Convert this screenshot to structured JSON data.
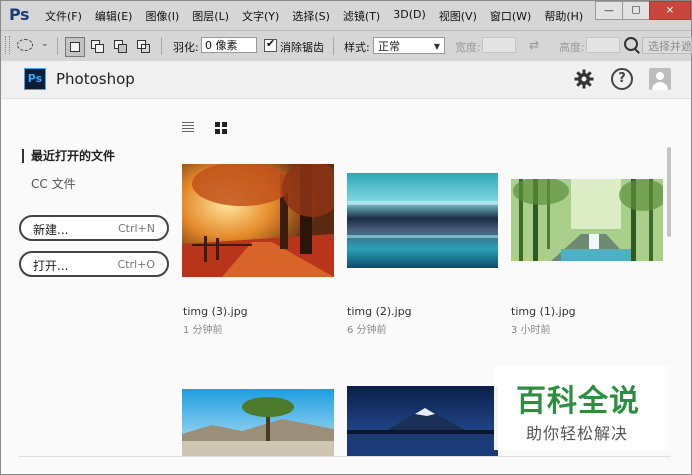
{
  "menubar": {
    "logo": "Ps",
    "items": [
      "文件(F)",
      "编辑(E)",
      "图像(I)",
      "图层(L)",
      "文字(Y)",
      "选择(S)",
      "滤镜(T)",
      "3D(D)",
      "视图(V)",
      "窗口(W)",
      "帮助(H)"
    ]
  },
  "options": {
    "feather_label": "羽化:",
    "feather_value": "0 像素",
    "antialias_label": "消除锯齿",
    "antialias_checked": true,
    "style_label": "样式:",
    "style_value": "正常",
    "width_label": "宽度:",
    "height_label": "高度:",
    "select_mask_label": "选择并遮住..."
  },
  "start": {
    "app_name": "Photoshop",
    "badge": "Ps",
    "nav": {
      "recent_label": "最近打开的文件",
      "cc_label": "CC 文件"
    },
    "new_button": {
      "label": "新建...",
      "shortcut": "Ctrl+N"
    },
    "open_button": {
      "label": "打开...",
      "shortcut": "Ctrl+O"
    },
    "files": [
      {
        "name": "timg (3).jpg",
        "time": "1 分钟前"
      },
      {
        "name": "timg (2).jpg",
        "time": "6 分钟前"
      },
      {
        "name": "timg (1).jpg",
        "time": "3 小时前"
      }
    ]
  },
  "watermark": {
    "title": "百科全说",
    "subtitle": "助你轻松解决"
  },
  "colors": {
    "menubar_bg": "#d6d6d6",
    "workspace_bg": "#fafafa",
    "ps_blue": "#31a8ff",
    "watermark_green": "#2b8f3f",
    "close_red": "#c9463d"
  }
}
